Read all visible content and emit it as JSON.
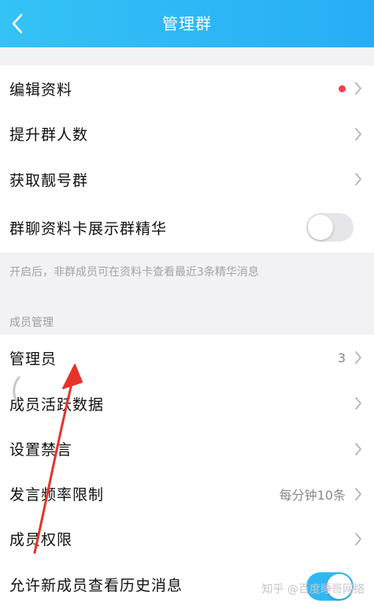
{
  "header": {
    "title": "管理群"
  },
  "rows": {
    "edit_profile": {
      "label": "编辑资料",
      "has_badge": true
    },
    "upgrade_size": {
      "label": "提升群人数"
    },
    "get_pretty_number": {
      "label": "获取靓号群"
    },
    "show_essence": {
      "label": "群聊资料卡展示群精华",
      "toggle_on": false
    }
  },
  "essence_note": "开启后，非群成员可在资料卡查看最近3条精华消息",
  "member_section": {
    "title": "成员管理",
    "admins": {
      "label": "管理员",
      "value": "3"
    },
    "activity_data": {
      "label": "成员活跃数据"
    },
    "mute": {
      "label": "设置禁言"
    },
    "speak_rate": {
      "label": "发言频率限制",
      "value": "每分钟10条"
    },
    "permissions": {
      "label": "成员权限"
    },
    "new_member_history": {
      "label": "允许新成员查看历史消息",
      "toggle_on": true
    }
  },
  "watermark": "知乎 @百度睡哥网络",
  "colors": {
    "header_gradient_start": "#35c3f5",
    "header_gradient_end": "#27adf6",
    "badge_red": "#ff3b4f",
    "toggle_on": "#2fb8f5",
    "annotation_arrow": "#e5332a"
  }
}
